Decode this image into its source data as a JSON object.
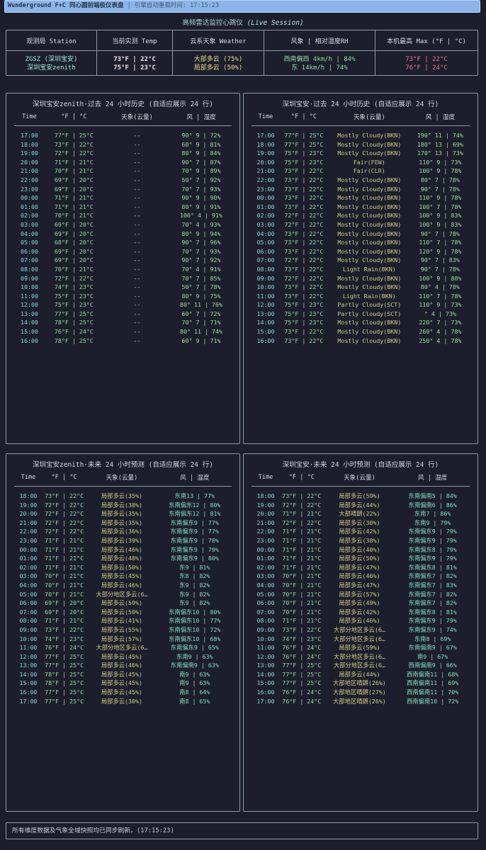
{
  "topbar": {
    "title": "Wunderground F+C 同心圆前端极仪表盘",
    "refresh": "| 引擎自动重载时间: 17:15:23"
  },
  "heartbeat": {
    "label": "高频雷达监控心跳仪",
    "session": "(Live Session)"
  },
  "summary": {
    "headers": [
      "观测局 Station",
      "当前实测 Temp",
      "云系天象 Weather",
      "风象 | 相对湿度RH",
      "本机最高 Max (°F | °C)"
    ],
    "rows": [
      {
        "station": "ZGSZ (深圳宝安)",
        "temp": "73°F | 22°C",
        "weather": "大部多云 (75%)",
        "wind_rh": "西南偏西 4km/h | 84%",
        "max": "73°F | 22°C"
      },
      {
        "station": "深圳宝安zenith",
        "temp": "75°F | 23°C",
        "weather": "局部多云 (50%)",
        "wind_rh": "东 14km/h | 74%",
        "max": "76°F | 24°C"
      }
    ]
  },
  "history_left": {
    "title": "深圳宝安zenith·过去 24 小时历史 (自适应展示 24 行)",
    "headers": [
      "Time",
      "°F | °C",
      "天象(云量)",
      "风 | 湿度"
    ],
    "rows": [
      [
        "17:00",
        "77°F | 25°C",
        "--",
        "90° 9 | 72%"
      ],
      [
        "18:00",
        "73°F | 22°C",
        "--",
        "60° 9 | 81%"
      ],
      [
        "19:00",
        "72°F | 22°C",
        "--",
        "80° 9 | 84%"
      ],
      [
        "20:00",
        "71°F | 21°C",
        "--",
        "90° 7 | 87%"
      ],
      [
        "21:00",
        "70°F | 21°C",
        "--",
        "70° 9 | 89%"
      ],
      [
        "22:00",
        "69°F | 20°C",
        "--",
        "50° 7 | 92%"
      ],
      [
        "23:00",
        "69°F | 20°C",
        "--",
        "70° 7 | 93%"
      ],
      [
        "00:00",
        "71°F | 21°C",
        "--",
        "90° 9 | 90%"
      ],
      [
        "01:00",
        "71°F | 21°C",
        "--",
        "80° 9 | 91%"
      ],
      [
        "02:00",
        "70°F | 21°C",
        "--",
        "100° 4 | 91%"
      ],
      [
        "03:00",
        "69°F | 20°C",
        "--",
        "70° 4 | 93%"
      ],
      [
        "04:00",
        "69°F | 20°C",
        "--",
        "80° 9 | 94%"
      ],
      [
        "05:00",
        "68°F | 20°C",
        "--",
        "90° 7 | 96%"
      ],
      [
        "06:00",
        "69°F | 20°C",
        "--",
        "70° 7 | 93%"
      ],
      [
        "07:00",
        "69°F | 20°C",
        "--",
        "90° 7 | 92%"
      ],
      [
        "08:00",
        "70°F | 21°C",
        "--",
        "70° 4 | 91%"
      ],
      [
        "09:00",
        "72°F | 22°C",
        "--",
        "70° 7 | 85%"
      ],
      [
        "10:00",
        "74°F | 23°C",
        "--",
        "50° 7 | 78%"
      ],
      [
        "11:00",
        "75°F | 23°C",
        "--",
        "80° 9 | 75%"
      ],
      [
        "12:00",
        "75°F | 23°C",
        "--",
        "80° 11 | 76%"
      ],
      [
        "13:00",
        "77°F | 25°C",
        "--",
        "60° 7 | 72%"
      ],
      [
        "14:00",
        "78°F | 25°C",
        "--",
        "70° 7 | 71%"
      ],
      [
        "15:00",
        "76°F | 24°C",
        "--",
        "80° 11 | 74%"
      ],
      [
        "16:00",
        "78°F | 25°C",
        "--",
        "60° 9 | 71%"
      ]
    ]
  },
  "history_right": {
    "title": "深圳宝安·过去 24 小时历史 (自适应展示 24 行)",
    "headers": [
      "Time",
      "°F | °C",
      "天象(云量)",
      "风 | 湿度"
    ],
    "rows": [
      [
        "17:00",
        "77°F | 25°C",
        "Mostly Cloudy(BKN)",
        "190° 11 | 74%"
      ],
      [
        "18:00",
        "77°F | 25°C",
        "Mostly Cloudy(BKN)",
        "180° 13 | 69%"
      ],
      [
        "19:00",
        "75°F | 23°C",
        "Mostly Cloudy(BKN)",
        "170° 13 | 73%"
      ],
      [
        "20:00",
        "75°F | 23°C",
        "Fair(FEW)",
        "110° 9 | 73%"
      ],
      [
        "21:00",
        "73°F | 22°C",
        "Fair(CLR)",
        "100° 9 | 78%"
      ],
      [
        "22:00",
        "73°F | 22°C",
        "Mostly Cloudy(BKN)",
        "80° 7 | 78%"
      ],
      [
        "23:00",
        "73°F | 22°C",
        "Mostly Cloudy(BKN)",
        "90° 7 | 78%"
      ],
      [
        "00:00",
        "73°F | 22°C",
        "Mostly Cloudy(BKN)",
        "110° 9 | 78%"
      ],
      [
        "01:00",
        "73°F | 22°C",
        "Mostly Cloudy(BKN)",
        "100° 7 | 78%"
      ],
      [
        "02:00",
        "72°F | 22°C",
        "Mostly Cloudy(BKN)",
        "100° 9 | 83%"
      ],
      [
        "03:00",
        "72°F | 22°C",
        "Mostly Cloudy(BKN)",
        "100° 9 | 83%"
      ],
      [
        "04:00",
        "73°F | 22°C",
        "Mostly Cloudy(BKN)",
        "90° 7 | 78%"
      ],
      [
        "05:00",
        "73°F | 22°C",
        "Mostly Cloudy(BKN)",
        "110° 7 | 78%"
      ],
      [
        "06:00",
        "73°F | 22°C",
        "Mostly Cloudy(BKN)",
        "120° 9 | 78%"
      ],
      [
        "07:00",
        "72°F | 22°C",
        "Mostly Cloudy(BKN)",
        "90° 7 | 83%"
      ],
      [
        "08:00",
        "73°F | 22°C",
        "Light Rain(BKN)",
        "90° 7 | 78%"
      ],
      [
        "09:00",
        "72°F | 22°C",
        "Mostly Cloudy(BKN)",
        "100° 9 | 88%"
      ],
      [
        "10:00",
        "73°F | 22°C",
        "Mostly Cloudy(BKN)",
        "80° 4 | 78%"
      ],
      [
        "11:00",
        "73°F | 22°C",
        "Light Rain(BKN)",
        "110° 7 | 78%"
      ],
      [
        "12:00",
        "75°F | 23°C",
        "Partly Cloudy(SCT)",
        "110° 9 | 73%"
      ],
      [
        "13:00",
        "75°F | 23°C",
        "Partly Cloudy(SCT)",
        "° 4 | 73%"
      ],
      [
        "14:00",
        "75°F | 23°C",
        "Mostly Cloudy(BKN)",
        "220° 7 | 73%"
      ],
      [
        "15:00",
        "73°F | 22°C",
        "Mostly Cloudy(BKN)",
        "260° 4 | 78%"
      ],
      [
        "16:00",
        "73°F | 22°C",
        "Mostly Cloudy(BKN)",
        "250° 4 | 78%"
      ]
    ]
  },
  "forecast_left": {
    "title": "深圳宝安zenith·未来 24 小时预测 (自适应展示 24 行)",
    "headers": [
      "Time",
      "°F | °C",
      "天象(云量)",
      "风 | 湿度"
    ],
    "rows": [
      [
        "18:00",
        "73°F | 22°C",
        "局部多云(35%)",
        "东南13 | 77%"
      ],
      [
        "19:00",
        "72°F | 22°C",
        "局部多云(38%)",
        "东南偏东12 | 80%"
      ],
      [
        "20:00",
        "72°F | 22°C",
        "局部多云(35%)",
        "东南偏东12 | 81%"
      ],
      [
        "21:00",
        "72°F | 22°C",
        "局部多云(35%)",
        "东南偏东9 | 77%"
      ],
      [
        "22:00",
        "72°F | 22°C",
        "局部多云(36%)",
        "东南偏东9 | 77%"
      ],
      [
        "23:00",
        "71°F | 21°C",
        "局部多云(39%)",
        "东南偏东9 | 78%"
      ],
      [
        "00:00",
        "71°F | 21°C",
        "局部多云(46%)",
        "东南偏东9 | 79%"
      ],
      [
        "01:00",
        "71°F | 21°C",
        "局部多云(48%)",
        "东南偏东9 | 80%"
      ],
      [
        "02:00",
        "71°F | 21°C",
        "局部多云(50%)",
        "东9 | 81%"
      ],
      [
        "03:00",
        "70°F | 21°C",
        "局部多云(45%)",
        "东8 | 82%"
      ],
      [
        "04:00",
        "70°F | 21°C",
        "局部多云(46%)",
        "东9 | 82%"
      ],
      [
        "05:00",
        "70°F | 21°C",
        "大部分地区多云(6…",
        "东9 | 82%"
      ],
      [
        "06:00",
        "69°F | 20°C",
        "局部多云(59%)",
        "东9 | 82%"
      ],
      [
        "07:00",
        "69°F | 20°C",
        "局部多云(50%)",
        "东南偏东10 | 80%"
      ],
      [
        "08:00",
        "71°F | 21°C",
        "局部多云(41%)",
        "东南偏东10 | 77%"
      ],
      [
        "09:00",
        "73°F | 22°C",
        "局部多云(55%)",
        "东南偏东10 | 72%"
      ],
      [
        "10:00",
        "74°F | 23°C",
        "局部多云(57%)",
        "东南偏东10 | 68%"
      ],
      [
        "11:00",
        "76°F | 24°C",
        "大部分地区多云(6…",
        "东南偏东9 | 65%"
      ],
      [
        "12:00",
        "77°F | 25°C",
        "局部多云(45%)",
        "东南9 | 63%"
      ],
      [
        "13:00",
        "77°F | 25°C",
        "局部多云(46%)",
        "东南偏南9 | 63%"
      ],
      [
        "14:00",
        "78°F | 25°C",
        "局部多云(45%)",
        "南9 | 63%"
      ],
      [
        "15:00",
        "78°F | 25°C",
        "局部多云(45%)",
        "南9 | 63%"
      ],
      [
        "16:00",
        "77°F | 25°C",
        "局部多云(45%)",
        "南8 | 64%"
      ],
      [
        "17:00",
        "77°F | 25°C",
        "局部多云(30%)",
        "南8 | 65%"
      ]
    ]
  },
  "forecast_right": {
    "title": "深圳宝安·未来 24 小时预测 (自适应展示 24 行)",
    "headers": [
      "Time",
      "°F | °C",
      "天象(云量)",
      "风 | 湿度"
    ],
    "rows": [
      [
        "18:00",
        "73°F | 22°C",
        "局部多云(59%)",
        "东南偏南5 | 84%"
      ],
      [
        "19:00",
        "72°F | 22°C",
        "局部多云(44%)",
        "东南偏南6 | 86%"
      ],
      [
        "20:00",
        "71°F | 21°C",
        "大部晴朗(22%)",
        "东南7 | 86%"
      ],
      [
        "21:00",
        "72°F | 22°C",
        "局部多云(30%)",
        "东南9 | 79%"
      ],
      [
        "22:00",
        "71°F | 21°C",
        "局部多云(42%)",
        "东南偏东9 | 79%"
      ],
      [
        "23:00",
        "71°F | 21°C",
        "局部多云(38%)",
        "东南偏东9 | 79%"
      ],
      [
        "00:00",
        "71°F | 21°C",
        "局部多云(40%)",
        "东南偏东8 | 79%"
      ],
      [
        "01:00",
        "71°F | 21°C",
        "局部多云(50%)",
        "东南偏东9 | 79%"
      ],
      [
        "02:00",
        "71°F | 21°C",
        "局部多云(47%)",
        "东南偏东8 | 81%"
      ],
      [
        "03:00",
        "70°F | 21°C",
        "局部多云(46%)",
        "东南偏东7 | 82%"
      ],
      [
        "04:00",
        "70°F | 21°C",
        "局部多云(47%)",
        "东南偏东7 | 83%"
      ],
      [
        "05:00",
        "70°F | 21°C",
        "局部多云(57%)",
        "东南偏东7 | 82%"
      ],
      [
        "06:00",
        "70°F | 21°C",
        "局部多云(49%)",
        "东南偏东7 | 82%"
      ],
      [
        "07:00",
        "70°F | 21°C",
        "局部多云(42%)",
        "东南偏东8 | 81%"
      ],
      [
        "08:00",
        "71°F | 21°C",
        "局部多云(46%)",
        "东南偏东9 | 79%"
      ],
      [
        "09:00",
        "73°F | 22°C",
        "大部分地区多云(6…",
        "东南偏东9 | 74%"
      ],
      [
        "10:00",
        "74°F | 23°C",
        "大部分地区多云(6…",
        "东南8 | 69%"
      ],
      [
        "11:00",
        "76°F | 24°C",
        "局部多云(59%)",
        "东南偏南9 | 67%"
      ],
      [
        "12:00",
        "76°F | 24°C",
        "大部分地区多云(6…",
        "南9 | 67%"
      ],
      [
        "13:00",
        "77°F | 25°C",
        "大部分地区多云(6…",
        "西南偏南9 | 66%"
      ],
      [
        "14:00",
        "77°F | 25°C",
        "局部多云(44%)",
        "西南偏南11 | 68%"
      ],
      [
        "15:00",
        "77°F | 25°C",
        "大部地区晴朗(26%)",
        "西南偏南11 | 69%"
      ],
      [
        "16:00",
        "76°F | 24°C",
        "大部地区晴朗(27%)",
        "西南偏南11 | 70%"
      ],
      [
        "17:00",
        "76°F | 24°C",
        "大部地区晴朗(26%)",
        "西南偏南10 | 72%"
      ]
    ]
  },
  "footer": {
    "text": "所有维度数据及气象全域快照均已同步刷新。(17:15:23)"
  }
}
